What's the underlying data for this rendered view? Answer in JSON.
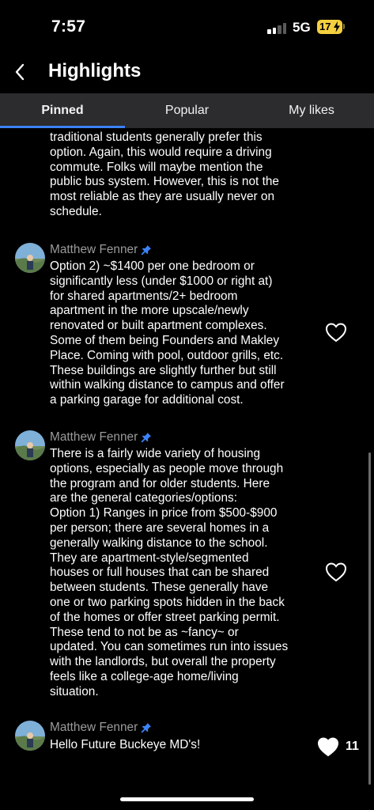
{
  "status": {
    "time": "7:57",
    "network": "5G",
    "battery": "17"
  },
  "header": {
    "title": "Highlights"
  },
  "tabs": [
    {
      "label": "Pinned",
      "active": true
    },
    {
      "label": "Popular",
      "active": false
    },
    {
      "label": "My likes",
      "active": false
    }
  ],
  "partial_post": {
    "lines": [
      "traditional students generally prefer this",
      "option. Again, this would require a driving",
      "commute. Folks will maybe mention the",
      "public bus system. However, this is not the",
      "most reliable as they are usually never on",
      "schedule."
    ]
  },
  "posts": [
    {
      "author": "Matthew Fenner",
      "lines": [
        "Option 2) ~$1400 per one bedroom or",
        "significantly less (under $1000 or right at)",
        "for shared apartments/2+ bedroom",
        "apartment in the more upscale/newly",
        "renovated or built apartment complexes.",
        "Some of them being Founders and Makley",
        "Place. Coming with pool, outdoor grills, etc.",
        "These buildings are slightly further but still",
        "within walking distance to campus and offer",
        "a parking garage for additional cost."
      ],
      "liked": false,
      "likes": ""
    },
    {
      "author": "Matthew Fenner",
      "lines": [
        "There is a fairly wide variety of housing",
        "options, especially as people move through",
        "the program and for older students. Here",
        "are the general categories/options:",
        "Option 1) Ranges in price from $500-$900",
        "per person; there are several homes in a",
        "generally walking distance to the school.",
        "They are apartment-style/segmented",
        "houses or full houses that can be shared",
        "between students. These generally have",
        "one or two parking spots hidden in the back",
        "of the homes or offer street parking permit.",
        "These tend to not be as ~fancy~ or",
        "updated. You can sometimes run into issues",
        "with the landlords, but overall the property",
        "feels like a college-age home/living",
        "situation."
      ],
      "liked": false,
      "likes": ""
    },
    {
      "author": "Matthew Fenner",
      "lines": [
        "Hello Future Buckeye MD's!"
      ],
      "liked": true,
      "likes": "11"
    }
  ],
  "colors": {
    "accent": "#3b82f6",
    "pin": "#3b82f6",
    "tab_bg": "#2c2c2e",
    "author": "#9b9b9b",
    "battery": "#f4d03f"
  },
  "icons": [
    "back-chevron-icon",
    "signal-icon",
    "battery-icon",
    "pin-icon",
    "heart-outline-icon",
    "heart-filled-icon"
  ]
}
